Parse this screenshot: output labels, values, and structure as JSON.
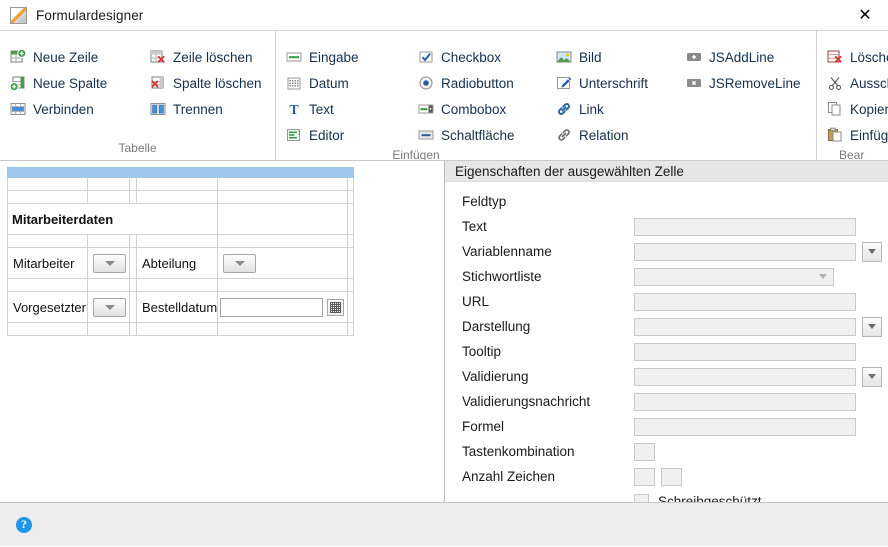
{
  "window": {
    "title": "Formulardesigner",
    "app_icon": "form-designer-icon",
    "close_label": "✕"
  },
  "ribbon": {
    "groups": [
      {
        "title": "Tabelle",
        "columns": [
          {
            "items": [
              {
                "label": "Neue Zeile",
                "icon": "table-add-row-icon"
              },
              {
                "label": "Neue Spalte",
                "icon": "table-add-column-icon"
              },
              {
                "label": "Verbinden",
                "icon": "table-merge-cells-icon"
              }
            ]
          },
          {
            "items": [
              {
                "label": "Zeile löschen",
                "icon": "table-delete-row-icon"
              },
              {
                "label": "Spalte löschen",
                "icon": "table-delete-column-icon"
              },
              {
                "label": "Trennen",
                "icon": "table-split-cells-icon"
              }
            ]
          }
        ]
      },
      {
        "title": "Einfügen",
        "columns": [
          {
            "items": [
              {
                "label": "Eingabe",
                "icon": "textinput-icon"
              },
              {
                "label": "Datum",
                "icon": "calendar-icon"
              },
              {
                "label": "Text",
                "icon": "text-t-icon"
              },
              {
                "label": "Editor",
                "icon": "editor-icon"
              }
            ]
          },
          {
            "items": [
              {
                "label": "Checkbox",
                "icon": "checkbox-icon"
              },
              {
                "label": "Radiobutton",
                "icon": "radiobutton-icon"
              },
              {
                "label": "Combobox",
                "icon": "combobox-icon"
              },
              {
                "label": "Schaltfläche",
                "icon": "button-icon"
              }
            ]
          },
          {
            "items": [
              {
                "label": "Bild",
                "icon": "image-icon"
              },
              {
                "label": "Unterschrift",
                "icon": "signature-icon"
              },
              {
                "label": "Link",
                "icon": "link-icon"
              },
              {
                "label": "Relation",
                "icon": "relation-icon"
              }
            ]
          },
          {
            "items": [
              {
                "label": "JSAddLine",
                "icon": "js-add-line-icon"
              },
              {
                "label": "JSRemoveLine",
                "icon": "js-remove-line-icon"
              }
            ]
          }
        ]
      },
      {
        "title": "Bear",
        "columns": [
          {
            "items": [
              {
                "label": "Lösche",
                "icon": "delete-icon"
              },
              {
                "label": "Aussch",
                "icon": "cut-scissors-icon"
              },
              {
                "label": "Kopier",
                "icon": "copy-icon"
              },
              {
                "label": "Einfüg",
                "icon": "paste-icon"
              }
            ]
          }
        ]
      }
    ]
  },
  "canvas": {
    "form_title": "Mitarbeiterdaten",
    "fields": {
      "mitarbeiter_label": "Mitarbeiter",
      "abteilung_label": "Abteilung",
      "vorgesetzter_label": "Vorgesetzter",
      "bestelldatum_label": "Bestelldatum",
      "bestelldatum_value": ""
    }
  },
  "properties": {
    "header": "Eigenschaften der ausgewählten Zelle",
    "rows": [
      {
        "label": "Feldtyp",
        "control": "none",
        "value": ""
      },
      {
        "label": "Text",
        "control": "text",
        "value": ""
      },
      {
        "label": "Variablenname",
        "control": "text-dd",
        "value": ""
      },
      {
        "label": "Stichwortliste",
        "control": "inner-dd",
        "value": ""
      },
      {
        "label": "URL",
        "control": "text",
        "value": ""
      },
      {
        "label": "Darstellung",
        "control": "text-dd",
        "value": ""
      },
      {
        "label": "Tooltip",
        "control": "text",
        "value": ""
      },
      {
        "label": "Validierung",
        "control": "text-dd",
        "value": ""
      },
      {
        "label": "Validierungsnachricht",
        "control": "text",
        "value": ""
      },
      {
        "label": "Formel",
        "control": "text",
        "value": ""
      },
      {
        "label": "Tastenkombination",
        "control": "small",
        "value": ""
      },
      {
        "label": "Anzahl Zeichen",
        "control": "small2",
        "value": ""
      }
    ],
    "checkbox": {
      "label": "Schreibgeschützt",
      "checked": false
    }
  },
  "statusbar": {
    "help_glyph": "?"
  },
  "colors": {
    "selection_blue": "#9ec7ea",
    "ribbon_text": "#15304d",
    "group_title": "#7a7a7a",
    "help_blue": "#1e97e8",
    "accent_orange": "#f0a22e"
  }
}
